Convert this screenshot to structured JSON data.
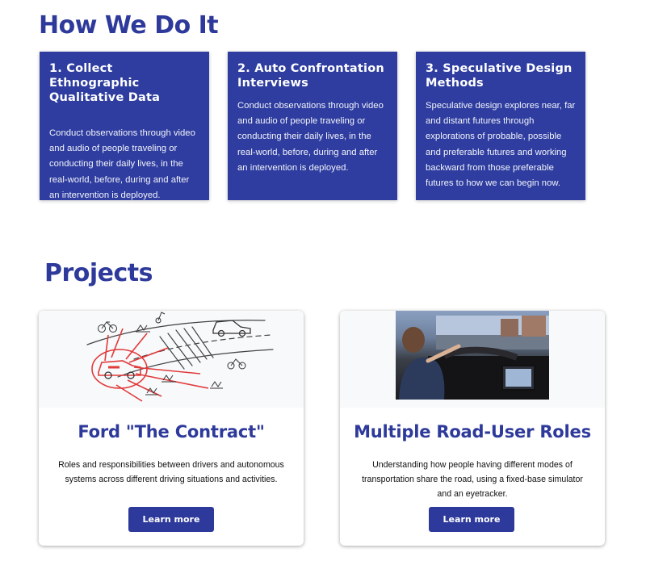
{
  "how_section": {
    "title": "How We Do It",
    "methods": [
      {
        "title": "1. Collect Ethnographic Qualitative Data",
        "description": "Conduct observations through video and audio of people traveling or conducting their daily lives, in the real-world, before, during and after an intervention is deployed."
      },
      {
        "title": "2. Auto Confrontation Interviews",
        "description": "Conduct observations through video and audio of people traveling or conducting their daily lives, in the real-world, before, during and after an intervention is deployed."
      },
      {
        "title": "3. Speculative Design Methods",
        "description": "Speculative design explores near, far and distant futures through explorations of probable, possible and preferable futures and working backward from those preferable futures to how we can begin now."
      }
    ]
  },
  "projects_section": {
    "title": "Projects",
    "projects": [
      {
        "title": "Ford \"The Contract\"",
        "description": "Roles and responsibilities between drivers and autonomous systems across different driving situations and activities.",
        "button_label": "Learn more"
      },
      {
        "title": "Multiple Road-User Roles",
        "description": "Understanding how people having different modes of transportation share the road, using a fixed-base simulator and an eyetracker.",
        "button_label": "Learn more"
      }
    ]
  },
  "colors": {
    "brand_blue": "#2e3a9b",
    "card_blue": "#2e3d9f",
    "sketch_red": "#e03a3a"
  }
}
